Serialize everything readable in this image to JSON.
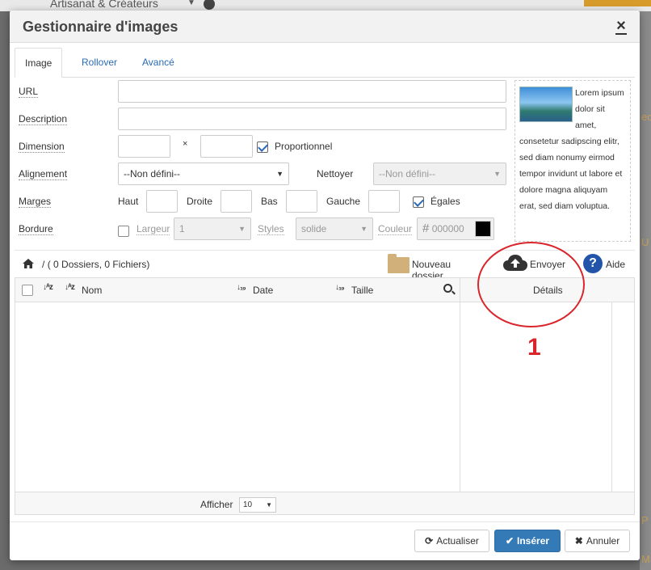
{
  "background": {
    "crumb": "Artisanat & Créateurs",
    "right_fragments": [
      "ec",
      "U",
      "P",
      "Ma"
    ]
  },
  "modal": {
    "title": "Gestionnaire d'images",
    "close_label": "×"
  },
  "tabs": [
    {
      "label": "Image"
    },
    {
      "label": "Rollover"
    },
    {
      "label": "Avancé"
    }
  ],
  "form": {
    "url_label": "URL",
    "url_value": "",
    "description_label": "Description",
    "description_value": "",
    "dimension_label": "Dimension",
    "dimension_sep": "×",
    "proportional_label": "Proportionnel",
    "alignment_label": "Alignement",
    "alignment_value": "--Non défini--",
    "clear_label": "Nettoyer",
    "clear_value": "--Non défini--",
    "margins_label": "Marges",
    "top_label": "Haut",
    "right_label": "Droite",
    "bottom_label": "Bas",
    "left_label": "Gauche",
    "equal_label": "Égales",
    "border_label": "Bordure",
    "width_label": "Largeur",
    "width_value": "1",
    "styles_label": "Styles",
    "styles_value": "solide",
    "color_label": "Couleur",
    "color_hash": "#",
    "color_value": "000000",
    "color_swatch": "#000000"
  },
  "preview": {
    "text": "Lorem ipsum dolor sit amet, consetetur sadipscing elitr, sed diam nonumy eirmod tempor invidunt ut labore et dolore magna aliquyam erat, sed diam voluptua."
  },
  "browser": {
    "path_sep": "/",
    "path_info": "( 0 Dossiers, 0 Fichiers)",
    "new_folder_label": "Nouveau dossier",
    "upload_label": "Envoyer",
    "help_label": "Aide",
    "help_glyph": "?",
    "columns": {
      "name": "Nom",
      "date": "Date",
      "size": "Taille",
      "details": "Détails"
    },
    "show_label": "Afficher",
    "show_value": "10"
  },
  "annotation": {
    "number": "1",
    "color": "#d9262d"
  },
  "buttons": {
    "refresh": "Actualiser",
    "insert": "Insérer",
    "cancel": "Annuler"
  },
  "colors": {
    "primary": "#337ab7",
    "link": "#2a6ab5",
    "folder": "#d2b07a"
  }
}
